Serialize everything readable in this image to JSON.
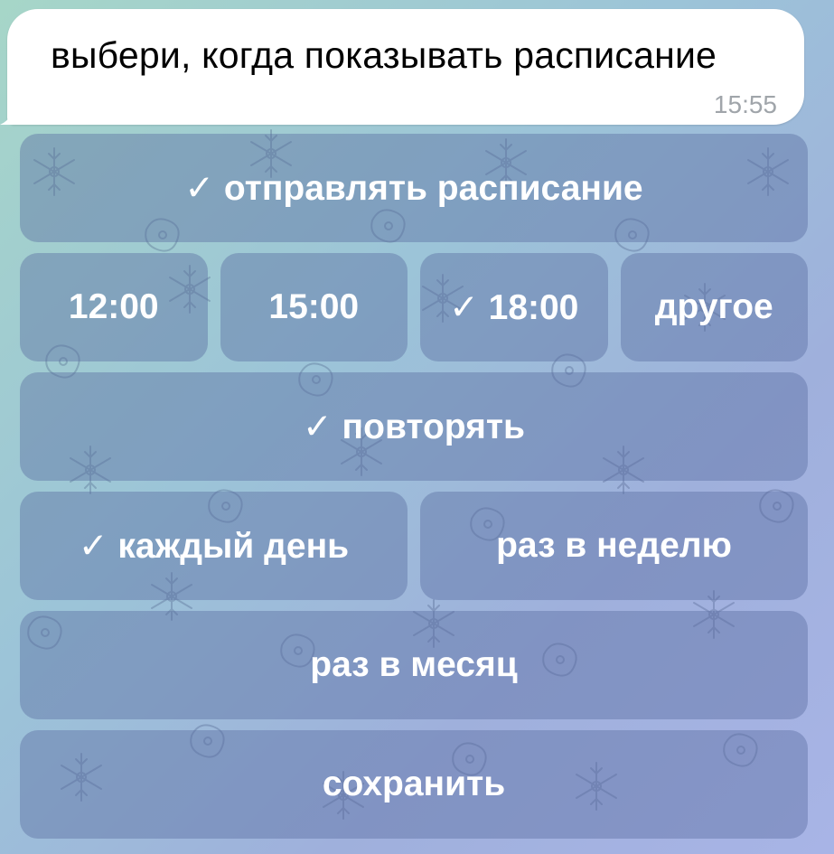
{
  "message": {
    "text": "выбери, когда показывать расписание",
    "time": "15:55"
  },
  "keyboard": {
    "send_schedule": "✓ отправлять расписание",
    "times": [
      "12:00",
      "15:00",
      "✓ 18:00",
      "другое"
    ],
    "repeat": "✓ повторять",
    "every_day": "✓ каждый день",
    "weekly": "раз в неделю",
    "monthly": "раз в месяц",
    "save": "сохранить"
  },
  "colors": {
    "bubble": "#ffffff",
    "button_bg": "rgba(88,108,160,0.42)",
    "button_text": "#ffffff",
    "time_text": "#a0a5aa"
  },
  "icons": [
    "checkmark-icon",
    "snowflake-pattern"
  ]
}
